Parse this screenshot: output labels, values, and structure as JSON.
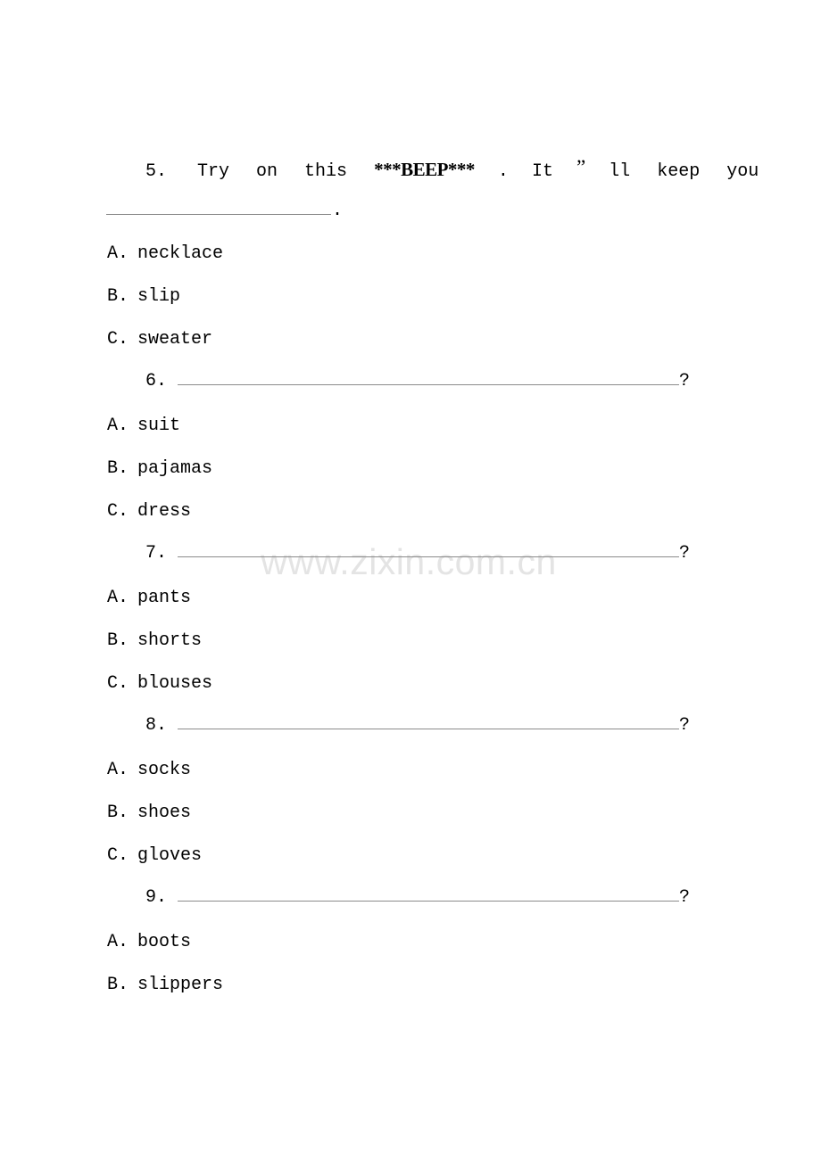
{
  "document": {
    "kind": "english-exam-worksheet",
    "background_color": "#ffffff",
    "text_color": "#000000",
    "rule_color": "#8a8a8a"
  },
  "watermark": {
    "text": "www.zixin.com.cn",
    "color": "#e4e4e4"
  },
  "questions": [
    {
      "number": "5.",
      "stem_words": {
        "w1": "Try",
        "w2": "on",
        "w3": "this",
        "beep": "***BEEP***",
        "period": ".",
        "w4": "It",
        "quote": "”",
        "w5": "ll",
        "w6": "keep",
        "w7": "you"
      },
      "trailing_punctuation": ".",
      "options": [
        {
          "letter": "A.",
          "text": "necklace"
        },
        {
          "letter": "B.",
          "text": "slip"
        },
        {
          "letter": "C.",
          "text": "sweater"
        }
      ]
    },
    {
      "number": "6.",
      "stem_words": {},
      "trailing_punctuation": "?",
      "options": [
        {
          "letter": "A.",
          "text": "suit"
        },
        {
          "letter": "B.",
          "text": "pajamas"
        },
        {
          "letter": "C.",
          "text": "dress"
        }
      ]
    },
    {
      "number": "7.",
      "stem_words": {},
      "trailing_punctuation": "?",
      "options": [
        {
          "letter": "A.",
          "text": "pants"
        },
        {
          "letter": "B.",
          "text": "shorts"
        },
        {
          "letter": "C.",
          "text": "blouses"
        }
      ]
    },
    {
      "number": "8.",
      "stem_words": {},
      "trailing_punctuation": "?",
      "options": [
        {
          "letter": "A.",
          "text": "socks"
        },
        {
          "letter": "B.",
          "text": "shoes"
        },
        {
          "letter": "C.",
          "text": "gloves"
        }
      ]
    },
    {
      "number": "9.",
      "stem_words": {},
      "trailing_punctuation": "?",
      "options": [
        {
          "letter": "A.",
          "text": "boots"
        },
        {
          "letter": "B.",
          "text": "slippers"
        }
      ]
    }
  ]
}
